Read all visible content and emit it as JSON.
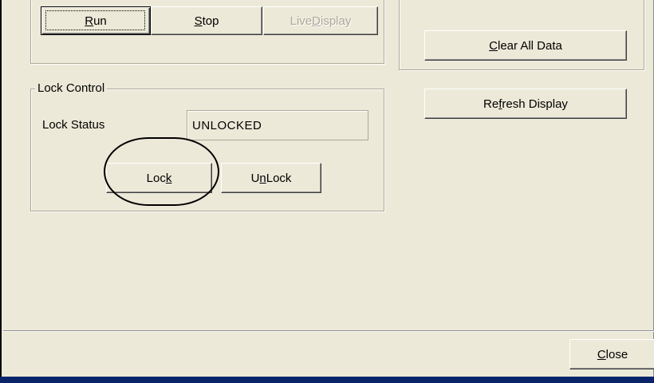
{
  "run_control": {
    "buttons": [
      {
        "label_pre": "",
        "hotkey": "R",
        "label_post": "un"
      },
      {
        "label_pre": "",
        "hotkey": "S",
        "label_post": "top"
      },
      {
        "label_pre": "Live ",
        "hotkey": "D",
        "label_post": "isplay"
      }
    ]
  },
  "data_control": {
    "clear_pre": "",
    "clear_hotkey": "C",
    "clear_post": "lear All Data",
    "refresh_pre": "Re",
    "refresh_hotkey": "f",
    "refresh_post": "resh Display"
  },
  "lock_control": {
    "title": "Lock Control",
    "status_label": "Lock Status",
    "status_value": "UNLOCKED",
    "lock_pre": "Loc",
    "lock_hotkey": "k",
    "lock_post": "",
    "unlock_pre": "U",
    "unlock_hotkey": "n",
    "unlock_post": "Lock"
  },
  "footer": {
    "close_pre": "",
    "close_hotkey": "C",
    "close_post": "lose"
  },
  "colors": {
    "dialog_bg": "#ece9d8",
    "title_bar_blue": "#0a246a",
    "disabled_text": "#aca899"
  }
}
